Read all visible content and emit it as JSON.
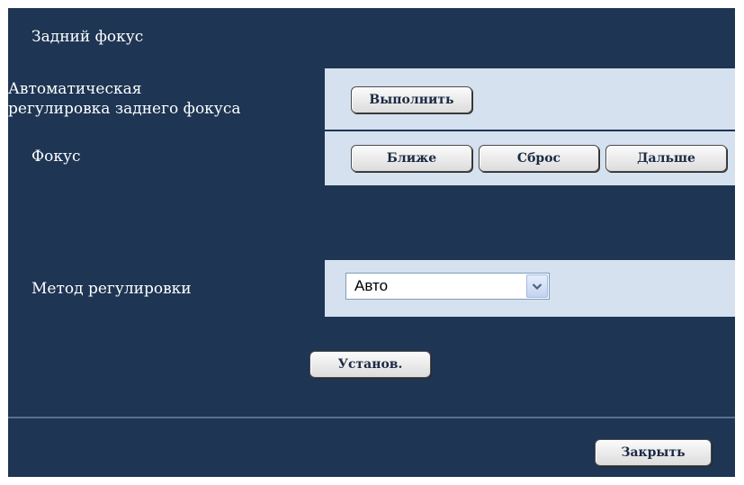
{
  "header": {
    "title": "Задний фокус"
  },
  "auto_focus": {
    "label_line1": "Автоматическая",
    "label_line2": "регулировка заднего фокуса",
    "execute_label": "Выполнить"
  },
  "focus": {
    "label": "Фокус",
    "near_label": "Ближе",
    "reset_label": "Сброс",
    "far_label": "Дальше"
  },
  "adjust_method": {
    "label": "Метод регулировки",
    "selected": "Авто"
  },
  "set_label": "Установ.",
  "close_label": "Закрыть",
  "icons": {
    "dropdown": "chevron-down-icon"
  },
  "colors": {
    "panel_bg": "#1e3554",
    "cell_bg": "#d5e1ef",
    "button_text": "#1b2a44"
  }
}
